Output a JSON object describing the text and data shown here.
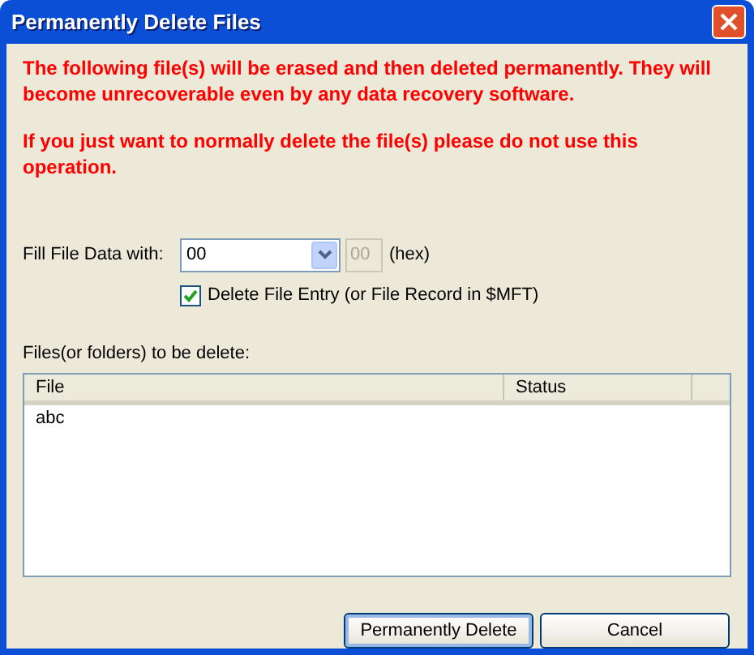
{
  "window": {
    "title": "Permanently Delete Files"
  },
  "warnings": [
    "The following file(s) will be erased and then deleted permanently. They will become unrecoverable even by any data recovery software.",
    "If you just want to normally delete the file(s) please do not use this operation."
  ],
  "fill": {
    "label": "Fill File Data with:",
    "dropdown_value": "00",
    "hex_value": "00",
    "hex_disabled": true,
    "hex_suffix": "(hex)"
  },
  "delete_entry": {
    "label": "Delete File Entry (or File Record in $MFT)",
    "checked": true
  },
  "files": {
    "label": "Files(or folders) to be delete:",
    "columns": [
      "File",
      "Status"
    ],
    "rows": [
      {
        "file": "abc",
        "status": ""
      }
    ]
  },
  "buttons": [
    {
      "label": "Permanently Delete",
      "default": true
    },
    {
      "label": "Cancel",
      "default": false
    }
  ]
}
